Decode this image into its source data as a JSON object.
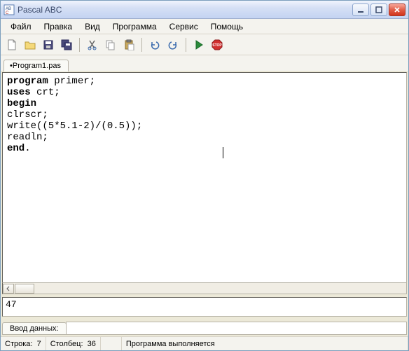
{
  "window": {
    "title": "Pascal ABC"
  },
  "menu": {
    "file": "Файл",
    "edit": "Правка",
    "view": "Вид",
    "program": "Программа",
    "service": "Сервис",
    "help": "Помощь"
  },
  "tabs": {
    "file1": "Program1.pas",
    "file1_prefix": "•"
  },
  "code": {
    "l1a": "program",
    "l1b": " primer;",
    "l2a": "uses",
    "l2b": " crt;",
    "l3": "begin",
    "l4": "clrscr;",
    "l5": "write((5*5.1-2)/(0.5));",
    "l6": "readln;",
    "l7a": "end",
    "l7b": "."
  },
  "output": {
    "value": "47"
  },
  "input": {
    "label": "Ввод данных:"
  },
  "status": {
    "line_label": "Строка:",
    "line_value": "7",
    "col_label": "Столбец:",
    "col_value": "36",
    "message": "Программа выполняется"
  }
}
